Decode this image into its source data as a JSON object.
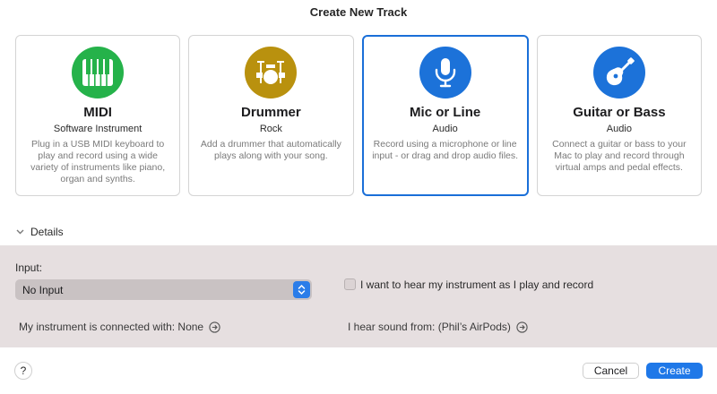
{
  "dialog": {
    "title": "Create New Track"
  },
  "cards": [
    {
      "name": "MIDI",
      "type": "Software Instrument",
      "description": "Plug in a USB MIDI keyboard to play and record using a wide variety of instruments like piano, organ and synths.",
      "icon": "piano-keys-icon",
      "color": "#25b24a",
      "selected": false
    },
    {
      "name": "Drummer",
      "type": "Rock",
      "description": "Add a drummer that automatically plays along with your song.",
      "icon": "drum-kit-icon",
      "color": "#b9910e",
      "selected": false
    },
    {
      "name": "Mic or Line",
      "type": "Audio",
      "description": "Record using a microphone or line input - or drag and drop audio files.",
      "icon": "microphone-icon",
      "color": "#1c72d9",
      "selected": true
    },
    {
      "name": "Guitar or Bass",
      "type": "Audio",
      "description": "Connect a guitar or bass to your Mac to play and record through virtual amps and pedal effects.",
      "icon": "guitar-icon",
      "color": "#1c72d9",
      "selected": false
    }
  ],
  "details": {
    "toggle_label": "Details",
    "input_label": "Input:",
    "input_value": "No Input",
    "monitor_label": "I want to hear my instrument as I play and record",
    "monitor_checked": false,
    "connection_text": "My instrument is connected with: None",
    "output_text": "I hear sound from: (Phil’s AirPods)"
  },
  "footer": {
    "help_label": "?",
    "cancel_label": "Cancel",
    "create_label": "Create"
  },
  "colors": {
    "accent": "#1f78e8",
    "panel": "#e6dfe0"
  }
}
